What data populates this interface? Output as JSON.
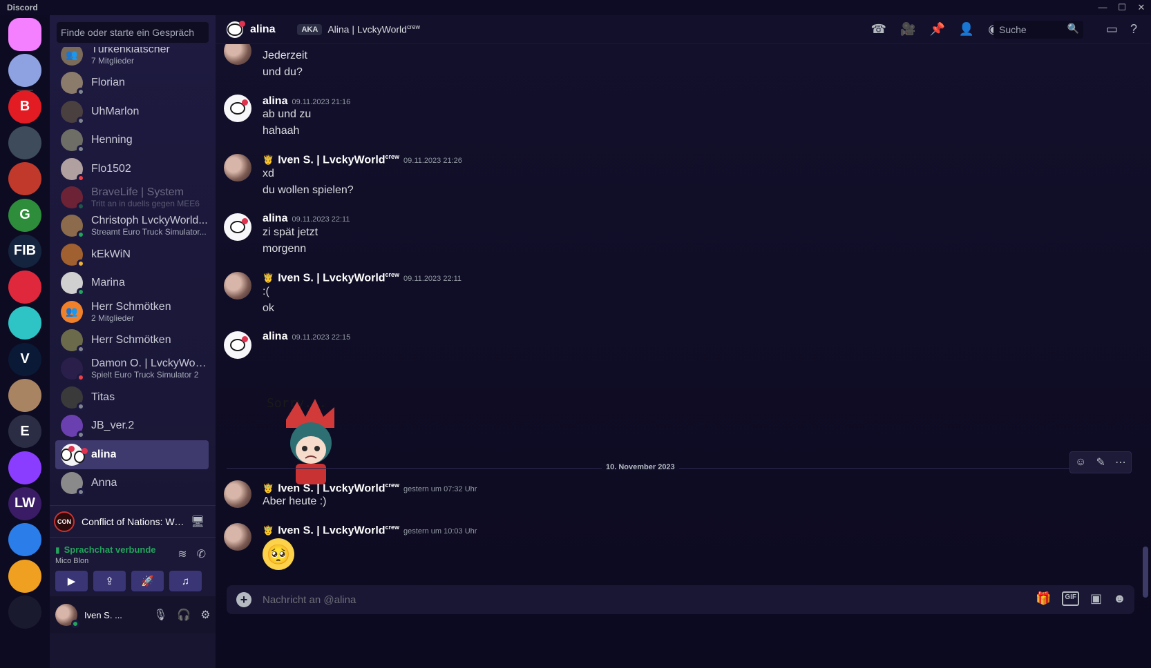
{
  "window": {
    "app_name": "Discord",
    "minimize": "—",
    "maximize": "☐",
    "close": "✕"
  },
  "servers": [
    {
      "label": "",
      "color": "#f47fff"
    },
    {
      "label": "",
      "color": "#8ea1e1"
    },
    {
      "label": "B",
      "color": "#e31b23"
    },
    {
      "label": "",
      "color": "#3d4b5a"
    },
    {
      "label": "",
      "color": "#c0392b"
    },
    {
      "label": "G",
      "color": "#2d8d3a"
    },
    {
      "label": "FIB",
      "color": "#15243e"
    },
    {
      "label": "",
      "color": "#e0283c"
    },
    {
      "label": "",
      "color": "#2ec4c5"
    },
    {
      "label": "V",
      "color": "#0a1a36"
    },
    {
      "label": "",
      "color": "#a98463"
    },
    {
      "label": "E",
      "color": "#2b2d44"
    },
    {
      "label": "",
      "color": "#8b3dff"
    },
    {
      "label": "LW",
      "color": "#3a1b66"
    },
    {
      "label": "",
      "color": "#2b7de9"
    },
    {
      "label": "",
      "color": "#f0a020"
    },
    {
      "label": "",
      "color": "#1a1a2e"
    }
  ],
  "sidebar": {
    "search_placeholder": "Finde oder starte ein Gespräch",
    "dms": [
      {
        "name": "Türkenklatscher",
        "sub": "7 Mitglieder",
        "status": "group",
        "color": "#7b6b5a"
      },
      {
        "name": "Florian",
        "sub": "",
        "status": "offline",
        "color": "#8b7b6b"
      },
      {
        "name": "UhMarlon",
        "sub": "",
        "status": "offline",
        "color": "#4a4040"
      },
      {
        "name": "Henning",
        "sub": "",
        "status": "offline",
        "color": "#6e6e66"
      },
      {
        "name": "Flo1502",
        "sub": "",
        "status": "dnd",
        "color": "#b0a0a0"
      },
      {
        "name": "BraveLife | System",
        "sub": "Tritt an in duells gegen MEE6",
        "status": "online",
        "color": "#d03030",
        "faded": true
      },
      {
        "name": "Christoph LvckyWorld...",
        "sub": "Streamt Euro Truck Simulator...",
        "status": "online",
        "color": "#8b6b4b"
      },
      {
        "name": "kEkWiN",
        "sub": "",
        "status": "idle",
        "color": "#a06030"
      },
      {
        "name": "Marina",
        "sub": "",
        "status": "online",
        "color": "#d0d0d0"
      },
      {
        "name": "Herr Schmötken",
        "sub": "2 Mitglieder",
        "status": "group",
        "color": "#f0802a"
      },
      {
        "name": "Herr Schmötken",
        "sub": "",
        "status": "offline",
        "color": "#6b6b4b"
      },
      {
        "name": "Damon O. | LvckyWorl...",
        "sub": "Spielt Euro Truck Simulator 2",
        "status": "dnd",
        "color": "#2a1f4a"
      },
      {
        "name": "Titas",
        "sub": "",
        "status": "offline",
        "color": "#3a3a3a"
      },
      {
        "name": "JB_ver.2",
        "sub": "",
        "status": "offline",
        "color": "#6a3fb0"
      },
      {
        "name": "alina",
        "sub": "",
        "status": "offline",
        "color": "#f4f4f7",
        "active": true
      },
      {
        "name": "Anna",
        "sub": "",
        "status": "offline",
        "color": "#8a8a8a"
      }
    ],
    "activity": {
      "game_icon_text": "CON",
      "game_name": "Conflict of Nations: Wo..."
    },
    "voice": {
      "status": "Sprachchat verbunde",
      "channel": "Mico Blon"
    },
    "user": {
      "name": "Iven S. ..."
    }
  },
  "header": {
    "name": "alina",
    "aka": "AKA",
    "aka_name": "Alina | LvckyWorld",
    "aka_sup": "crew",
    "search_placeholder": "Suche"
  },
  "messages": [
    {
      "type": "cont",
      "lines": [
        "Jederzeit",
        "und du?"
      ]
    },
    {
      "type": "head",
      "author": "alina",
      "time": "09.11.2023 21:16",
      "av": "alina",
      "lines": [
        "ab und zu",
        "hahaah"
      ]
    },
    {
      "type": "head",
      "author": "Iven S. | LvckyWorld",
      "sup": "crew",
      "prefix": "🤴",
      "time": "09.11.2023 21:26",
      "av": "iven",
      "lines": [
        "xd",
        "du wollen spielen?"
      ]
    },
    {
      "type": "head",
      "author": "alina",
      "time": "09.11.2023 22:11",
      "av": "alina",
      "lines": [
        "zi spät jetzt",
        "morgenn"
      ]
    },
    {
      "type": "head",
      "author": "Iven S. | LvckyWorld",
      "sup": "crew",
      "prefix": "🤴",
      "time": "09.11.2023 22:11",
      "av": "iven",
      "lines": [
        ":(",
        "ok"
      ]
    },
    {
      "type": "head",
      "author": "alina",
      "time": "09.11.2023 22:15",
      "av": "alina",
      "lines": [],
      "sticker_text": "Sorry..."
    }
  ],
  "date_divider": "10. November 2023",
  "later_messages": [
    {
      "author": "Iven S. | LvckyWorld",
      "sup": "crew",
      "prefix": "🤴",
      "time": "gestern um 07:32 Uhr",
      "line": "Aber heute :)"
    },
    {
      "author": "Iven S. | LvckyWorld",
      "sup": "crew",
      "prefix": "🤴",
      "time": "gestern um 10:03 Uhr",
      "emoji": "🥺"
    }
  ],
  "composer": {
    "placeholder": "Nachricht an @alina",
    "gif": "GIF"
  }
}
